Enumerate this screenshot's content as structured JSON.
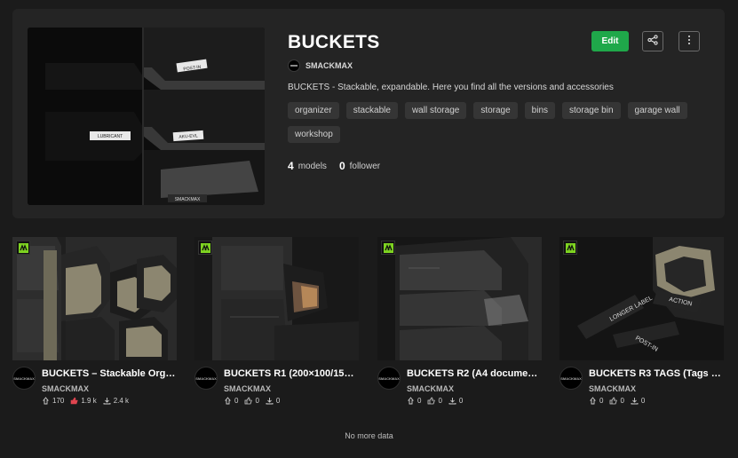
{
  "collection": {
    "title": "BUCKETS",
    "author": "SMACKMAX",
    "description": "BUCKETS - Stackable, expandable. Here you find all the versions and accessories",
    "tags": [
      "organizer",
      "stackable",
      "wall storage",
      "storage",
      "bins",
      "storage bin",
      "garage wall",
      "workshop"
    ],
    "models_count": "4",
    "models_label": "models",
    "followers_count": "0",
    "followers_label": "follower",
    "edit_label": "Edit",
    "cover_labels": {
      "label1": "POST-IN",
      "label2": "LUBRICANT",
      "label3": "AKU-EVL",
      "label4": "SMACKMAX"
    },
    "icons": {
      "share": "share-icon",
      "more": "more-vertical-icon"
    }
  },
  "models": [
    {
      "title": "BUCKETS – Stackable Orga...",
      "author": "SMACKMAX",
      "avatar_text": "SMACKMAX",
      "downloads_stat": "170",
      "likes": "1.9 k",
      "downloads": "2.4 k",
      "liked": true
    },
    {
      "title": "BUCKETS R1 (200×100/150×...",
      "author": "SMACKMAX",
      "avatar_text": "SMACKMAX",
      "downloads_stat": "0",
      "likes": "0",
      "downloads": "0",
      "liked": false
    },
    {
      "title": "BUCKETS R2 (A4 document...",
      "author": "SMACKMAX",
      "avatar_text": "SMACKMAX",
      "downloads_stat": "0",
      "likes": "0",
      "downloads": "0",
      "liked": false
    },
    {
      "title": "BUCKETS R3 TAGS (Tags for...",
      "author": "SMACKMAX",
      "avatar_text": "SMACKMAX",
      "downloads_stat": "0",
      "likes": "0",
      "downloads": "0",
      "liked": false
    }
  ],
  "model_thumb_labels": {
    "card4_a": "LONGER LABEL",
    "card4_b": "ACTION",
    "card4_c": "POST-IN"
  },
  "footer": {
    "note": "No more data"
  },
  "colors": {
    "accent": "#1fa84a",
    "badge": "#7ed321",
    "like": "#e0454f",
    "background": "#1b1b1b",
    "card": "#242424"
  }
}
